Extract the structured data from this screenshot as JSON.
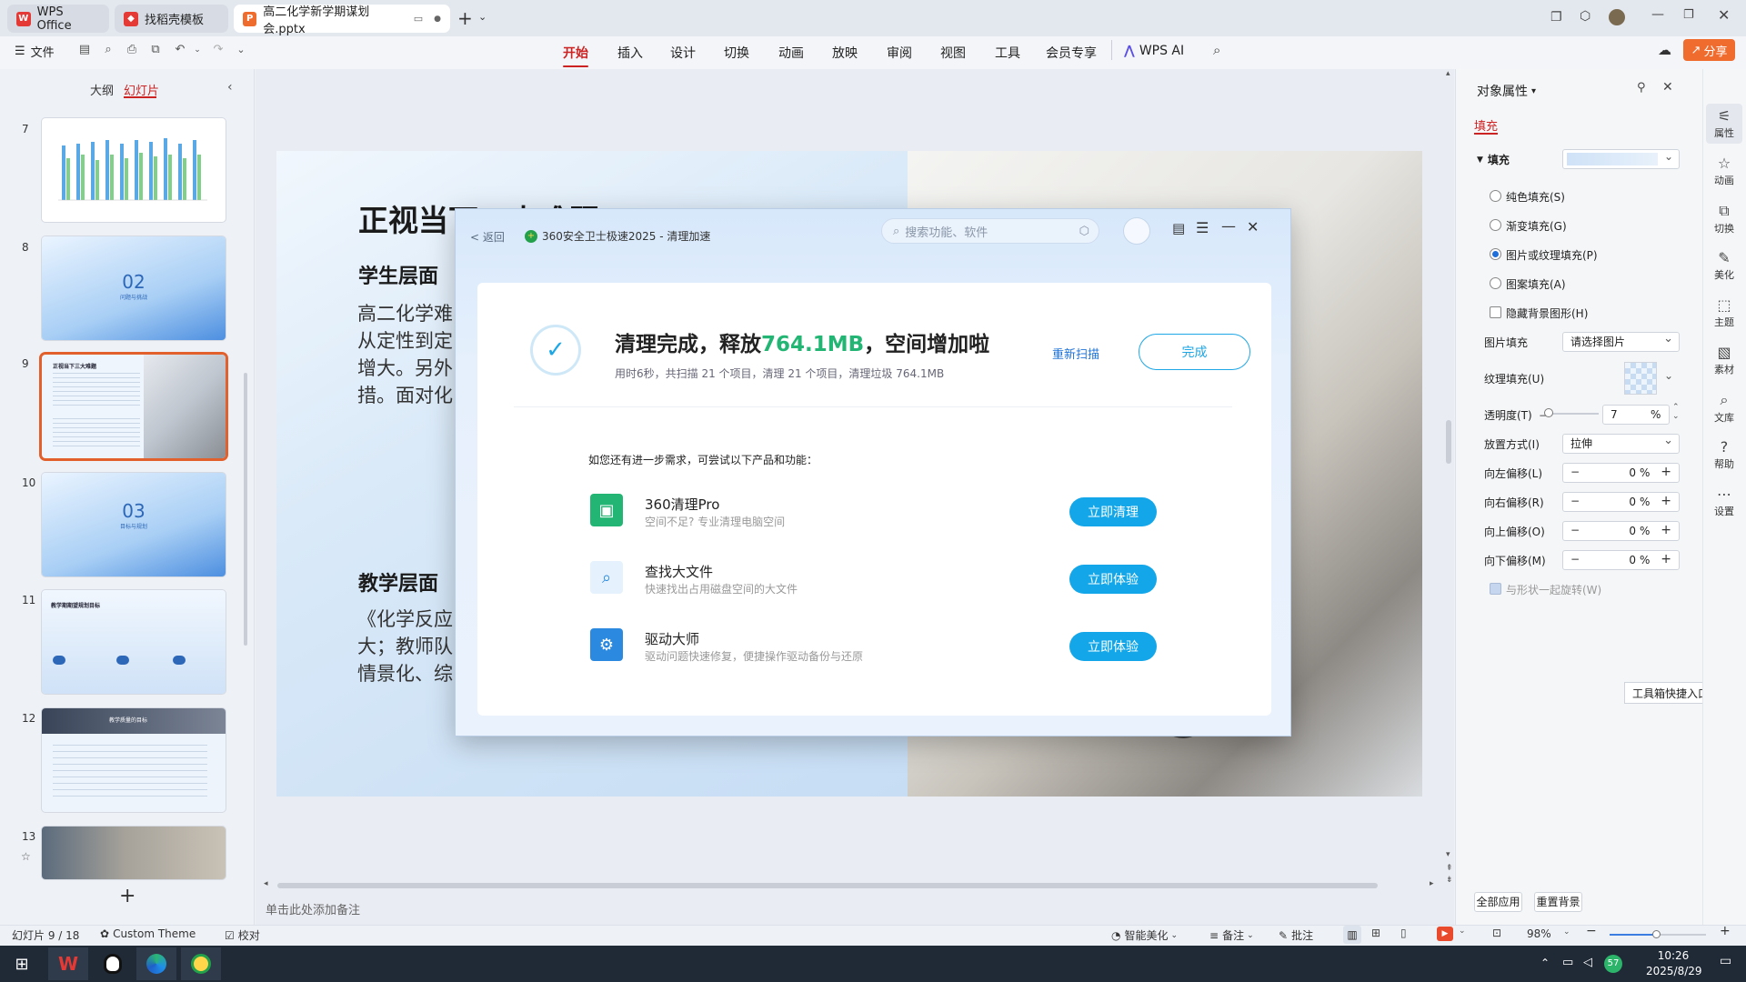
{
  "tabs": [
    {
      "label": "WPS Office"
    },
    {
      "label": "找稻壳模板"
    },
    {
      "label": "高二化学新学期谋划会.pptx"
    }
  ],
  "menu": {
    "file": "文件",
    "items": [
      "开始",
      "插入",
      "设计",
      "切换",
      "动画",
      "放映",
      "审阅",
      "视图",
      "工具",
      "会员专享",
      "WPS AI"
    ],
    "share": "分享"
  },
  "left_panel": {
    "tabs": [
      "大纲",
      "幻灯片"
    ],
    "slides": [
      {
        "num": "7"
      },
      {
        "num": "8",
        "big": "02",
        "small": "问题与挑战"
      },
      {
        "num": "9",
        "title": "正视当下三大难题"
      },
      {
        "num": "10",
        "big": "03",
        "small": "目标与规划"
      },
      {
        "num": "11",
        "title": "教学期期望规划目标"
      },
      {
        "num": "12",
        "title": "教学质量的目标"
      },
      {
        "num": "13"
      }
    ]
  },
  "slide": {
    "title": "正视当下三大难题",
    "h1": "学生层面",
    "lines1": [
      "高二化学难",
      "从定性到定",
      "增大。另外",
      "措。面对化"
    ],
    "h2": "教学层面",
    "lines2": [
      "《化学反应",
      "大；教师队",
      "情景化、综"
    ]
  },
  "dialog": {
    "back": "< 返回",
    "app_title": "360安全卫士极速2025 - 清理加速",
    "search_placeholder": "搜索功能、软件",
    "result_prefix": "清理完成，释放",
    "result_amount": "764.1MB",
    "result_suffix": "，空间增加啦",
    "result_detail": "用时6秒，共扫描 21 个项目，清理 21 个项目，清理垃圾 764.1MB",
    "rescan": "重新扫描",
    "done": "完成",
    "suggest": "如您还有进一步需求，可尝试以下产品和功能：",
    "products": [
      {
        "name": "360清理Pro",
        "desc": "空间不足? 专业清理电脑空间",
        "action": "立即清理"
      },
      {
        "name": "查找大文件",
        "desc": "快速找出占用磁盘空间的大文件",
        "action": "立即体验"
      },
      {
        "name": "驱动大师",
        "desc": "驱动问题快速修复，便捷操作驱动备份与还原",
        "action": "立即体验"
      }
    ]
  },
  "right_panel": {
    "title": "对象属性",
    "tab": "填充",
    "section": "填充",
    "options": [
      "纯色填充(S)",
      "渐变填充(G)",
      "图片或纹理填充(P)",
      "图案填充(A)"
    ],
    "hide_bg": "隐藏背景图形(H)",
    "picture_fill_label": "图片填充",
    "picture_fill_value": "请选择图片",
    "texture_label": "纹理填充(U)",
    "transparency_label": "透明度(T)",
    "transparency_value": "7",
    "transparency_unit": "%",
    "placement_label": "放置方式(I)",
    "placement_value": "拉伸",
    "offsets": [
      {
        "label": "向左偏移(L)",
        "value": "0"
      },
      {
        "label": "向右偏移(R)",
        "value": "0"
      },
      {
        "label": "向上偏移(O)",
        "value": "0"
      },
      {
        "label": "向下偏移(M)",
        "value": "0"
      }
    ],
    "rotate_with_shape": "与形状一起旋转(W)",
    "apply_all": "全部应用",
    "reset_bg": "重置背景",
    "tooltip": "工具箱快捷入口"
  },
  "sidebar": [
    "属性",
    "动画",
    "切换",
    "美化",
    "主题",
    "素材",
    "文库",
    "帮助",
    "设置"
  ],
  "notes_placeholder": "单击此处添加备注",
  "status": {
    "slide_info": "幻灯片 9 / 18",
    "theme": "Custom Theme",
    "proof": "校对",
    "beautify": "智能美化",
    "notes": "备注",
    "comments": "批注",
    "zoom": "98%"
  },
  "taskbar": {
    "time": "10:26",
    "date": "2025/8/29",
    "badge": "57"
  },
  "colors": {
    "accent_red": "#c22222",
    "dialog_blue": "#13a7ea",
    "green_amount": "#22b573",
    "share_orange": "#f06b2e"
  }
}
